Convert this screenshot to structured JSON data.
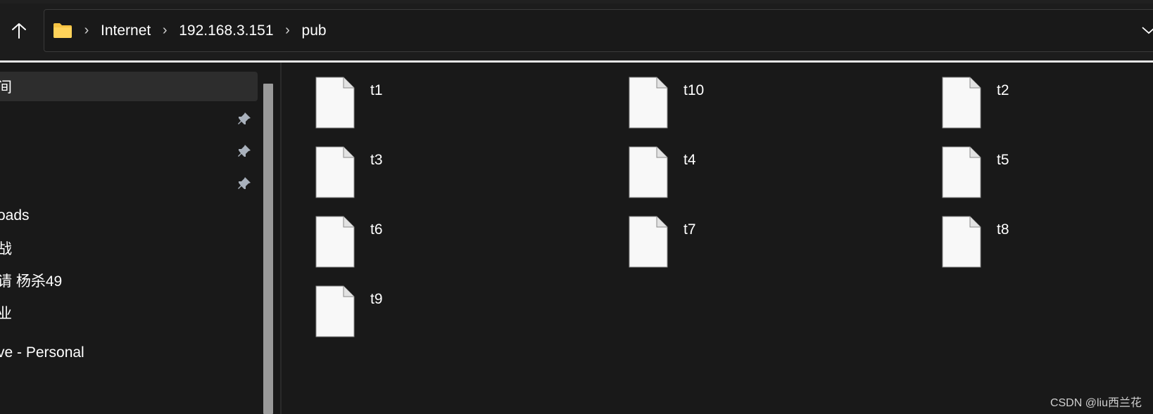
{
  "address": {
    "crumbs": [
      "Internet",
      "192.168.3.151",
      "pub"
    ]
  },
  "sidebar": {
    "items": [
      {
        "label": "间",
        "selected": true,
        "pinned": false
      },
      {
        "label": "",
        "selected": false,
        "pinned": true
      },
      {
        "label": "",
        "selected": false,
        "pinned": true
      },
      {
        "label": "",
        "selected": false,
        "pinned": true
      },
      {
        "label": "oads",
        "selected": false,
        "pinned": false
      },
      {
        "label": "战",
        "selected": false,
        "pinned": false
      },
      {
        "label": "请  杨杀49",
        "selected": false,
        "pinned": false
      },
      {
        "label": "业",
        "selected": false,
        "pinned": false
      },
      {
        "label": "ve - Personal",
        "selected": false,
        "pinned": false
      }
    ]
  },
  "files": [
    {
      "name": "t1"
    },
    {
      "name": "t10"
    },
    {
      "name": "t2"
    },
    {
      "name": "t3"
    },
    {
      "name": "t4"
    },
    {
      "name": "t5"
    },
    {
      "name": "t6"
    },
    {
      "name": "t7"
    },
    {
      "name": "t8"
    },
    {
      "name": "t9"
    }
  ],
  "watermark": "CSDN @liu西兰花",
  "colors": {
    "background": "#191919",
    "selected": "#2d2d2d",
    "folder": "#f6c343",
    "file_icon": "#f8f8f8"
  }
}
